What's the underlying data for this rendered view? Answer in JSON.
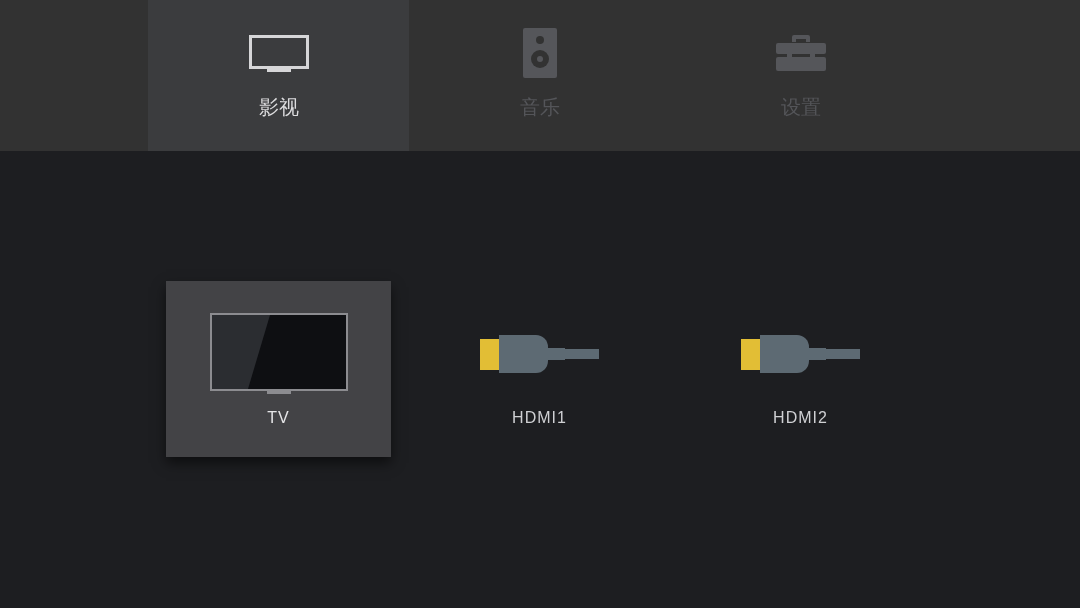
{
  "tabs": [
    {
      "label": "影视",
      "kind": "tv",
      "selected": true
    },
    {
      "label": "音乐",
      "kind": "speaker",
      "selected": false
    },
    {
      "label": "设置",
      "kind": "toolbox",
      "selected": false
    }
  ],
  "sources": [
    {
      "label": "TV",
      "kind": "tv",
      "selected": true
    },
    {
      "label": "HDMI1",
      "kind": "hdmi",
      "selected": false
    },
    {
      "label": "HDMI2",
      "kind": "hdmi",
      "selected": false
    }
  ]
}
